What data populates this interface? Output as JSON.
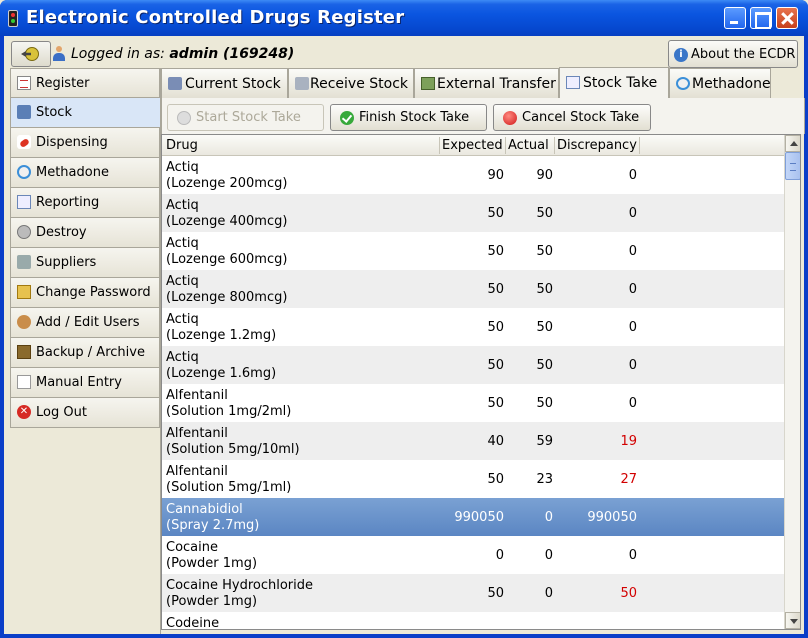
{
  "window": {
    "title": "Electronic Controlled Drugs Register"
  },
  "topbar": {
    "logged_prefix": "Logged in as:",
    "user": "admin (169248)",
    "about_label": "About the ECDR"
  },
  "sidebar": {
    "items": [
      {
        "label": "Register",
        "icon": "register-icon"
      },
      {
        "label": "Stock",
        "icon": "stock-icon"
      },
      {
        "label": "Dispensing",
        "icon": "pill-icon"
      },
      {
        "label": "Methadone",
        "icon": "clock-icon"
      },
      {
        "label": "Reporting",
        "icon": "report-icon"
      },
      {
        "label": "Destroy",
        "icon": "destroy-icon"
      },
      {
        "label": "Suppliers",
        "icon": "supplier-icon"
      },
      {
        "label": "Change Password",
        "icon": "password-icon"
      },
      {
        "label": "Add / Edit Users",
        "icon": "users-icon"
      },
      {
        "label": "Backup / Archive",
        "icon": "archive-icon"
      },
      {
        "label": "Manual Entry",
        "icon": "manual-entry-icon"
      },
      {
        "label": "Log Out",
        "icon": "logout-icon"
      }
    ],
    "active": "Stock"
  },
  "tabs": {
    "items": [
      {
        "label": "Current Stock",
        "icon": "truck-icon"
      },
      {
        "label": "Receive Stock",
        "icon": "receive-icon"
      },
      {
        "label": "External Transfer",
        "icon": "transfer-icon"
      },
      {
        "label": "Stock Take",
        "icon": "clipboard-icon"
      },
      {
        "label": "Methadone",
        "icon": "clock-icon"
      }
    ],
    "active": "Stock Take"
  },
  "actions": {
    "start_label": "Start Stock Take",
    "finish_label": "Finish Stock Take",
    "cancel_label": "Cancel Stock Take"
  },
  "table": {
    "columns": [
      "Drug",
      "Expected",
      "Actual",
      "Discrepancy"
    ],
    "rows": [
      {
        "name": "Actiq",
        "form": "(Lozenge 200mcg)",
        "expected": "90",
        "actual": "90",
        "discrepancy": "0"
      },
      {
        "name": "Actiq",
        "form": "(Lozenge 400mcg)",
        "expected": "50",
        "actual": "50",
        "discrepancy": "0"
      },
      {
        "name": "Actiq",
        "form": "(Lozenge 600mcg)",
        "expected": "50",
        "actual": "50",
        "discrepancy": "0"
      },
      {
        "name": "Actiq",
        "form": "(Lozenge 800mcg)",
        "expected": "50",
        "actual": "50",
        "discrepancy": "0"
      },
      {
        "name": "Actiq",
        "form": "(Lozenge 1.2mg)",
        "expected": "50",
        "actual": "50",
        "discrepancy": "0"
      },
      {
        "name": "Actiq",
        "form": "(Lozenge 1.6mg)",
        "expected": "50",
        "actual": "50",
        "discrepancy": "0"
      },
      {
        "name": "Alfentanil",
        "form": "(Solution 1mg/2ml)",
        "expected": "50",
        "actual": "50",
        "discrepancy": "0"
      },
      {
        "name": "Alfentanil",
        "form": "(Solution 5mg/10ml)",
        "expected": "40",
        "actual": "59",
        "discrepancy": "19"
      },
      {
        "name": "Alfentanil",
        "form": "(Solution 5mg/1ml)",
        "expected": "50",
        "actual": "23",
        "discrepancy": "27"
      },
      {
        "name": "Cannabidiol",
        "form": "(Spray 2.7mg)",
        "expected": "990050",
        "actual": "0",
        "discrepancy": "990050"
      },
      {
        "name": "Cocaine",
        "form": "(Powder 1mg)",
        "expected": "0",
        "actual": "0",
        "discrepancy": "0"
      },
      {
        "name": "Cocaine Hydrochloride",
        "form": "(Powder 1mg)",
        "expected": "50",
        "actual": "0",
        "discrepancy": "50"
      },
      {
        "name": "Codeine",
        "form": "",
        "expected": "",
        "actual": "",
        "discrepancy": ""
      }
    ],
    "selected_row": 9,
    "red_rows": [
      7,
      8,
      11
    ],
    "discrepancy_color": "#d20000",
    "selection_color": "#6a93cb"
  }
}
